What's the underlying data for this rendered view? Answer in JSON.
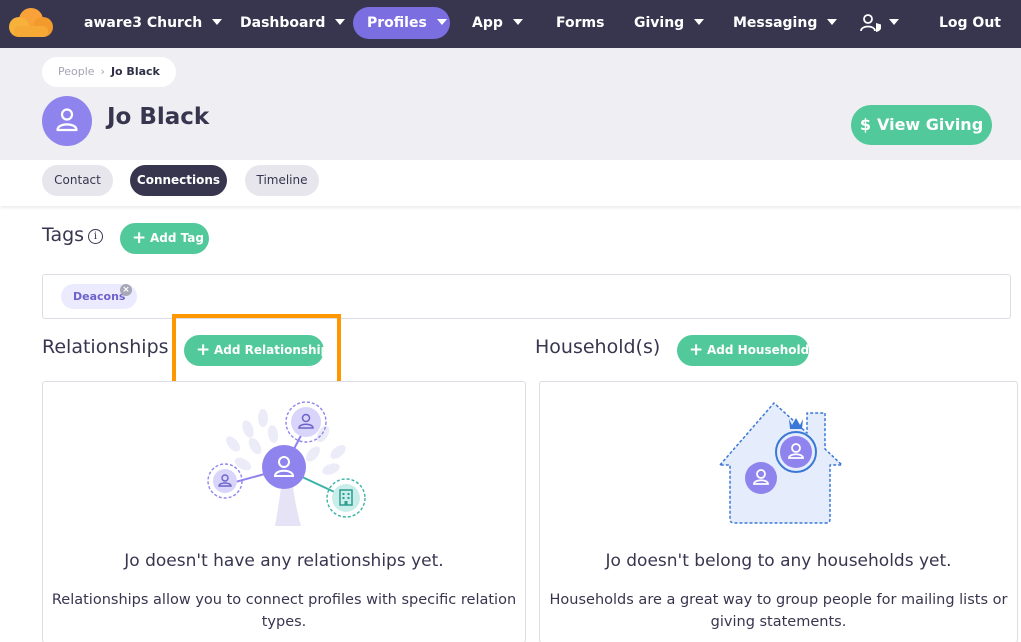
{
  "nav": {
    "church": "aware3 Church",
    "items": [
      {
        "label": "Dashboard"
      },
      {
        "label": "Profiles"
      },
      {
        "label": "App"
      },
      {
        "label": "Forms"
      },
      {
        "label": "Giving"
      },
      {
        "label": "Messaging"
      }
    ],
    "logout": "Log Out"
  },
  "breadcrumb": {
    "parent": "People",
    "current": "Jo Black"
  },
  "profile": {
    "name": "Jo Black",
    "view_giving": "View Giving"
  },
  "tabs": [
    "Contact",
    "Connections",
    "Timeline"
  ],
  "tags": {
    "title": "Tags",
    "info": "i",
    "add_label": "Add Tag",
    "items": [
      "Deacons"
    ]
  },
  "relationships": {
    "title": "Relationships",
    "add_label": "Add Relationship",
    "empty_title": "Jo doesn't have any relationships yet.",
    "empty_desc": "Relationships allow you to connect profiles with specific relation types."
  },
  "households": {
    "title": "Household(s)",
    "add_label": "Add Household",
    "empty_title": "Jo doesn't belong to any households yet.",
    "empty_desc": "Households are a great way to group people for mailing lists or giving statements."
  },
  "colors": {
    "nav_bg": "#38364f",
    "active_nav": "#7a6ee0",
    "green": "#52c99a",
    "purple": "#8f84ee",
    "highlight": "#ff9800"
  }
}
